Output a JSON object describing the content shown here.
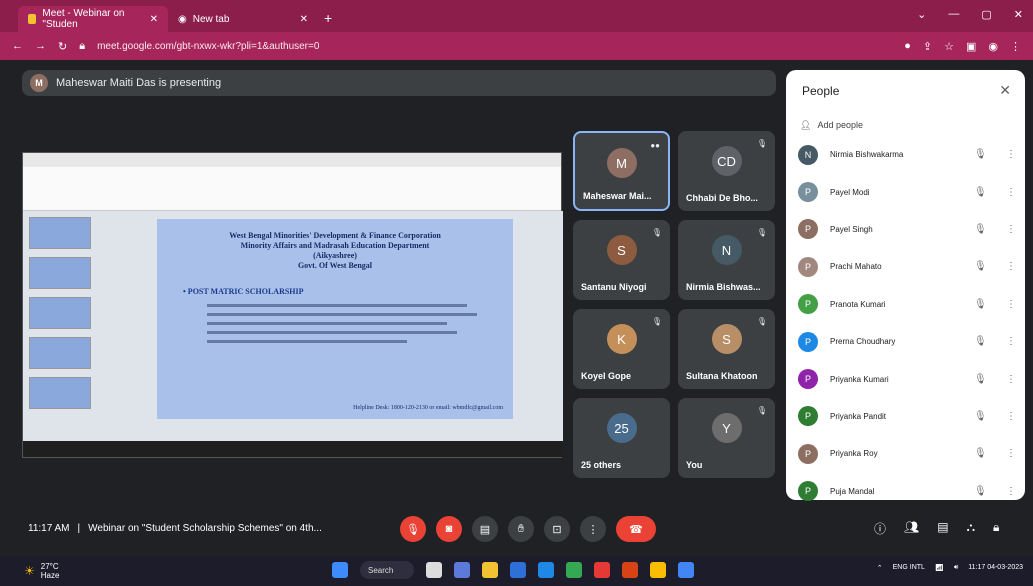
{
  "browser": {
    "tabs": [
      {
        "label": "Meet - Webinar on \"Studen",
        "active": true
      },
      {
        "label": "New tab",
        "active": false
      }
    ],
    "url": "meet.google.com/gbt-nxwx-wkr?pli=1&authuser=0",
    "accent": "#a6265c"
  },
  "presenting_banner": "Maheswar Maiti Das is presenting",
  "presenter_initial": "M",
  "shared_slide": {
    "title_line1": "West Bengal Minorities' Development & Finance Corporation",
    "title_line2": "Minority Affairs and Madrasah Education Department",
    "title_line3": "(Aikyashree)",
    "title_line4": "Govt. Of West Bengal",
    "heading": "• POST MATRIC SCHOLARSHIP",
    "contact": "Helpline Desk: 1800-120-2130 or email: wbmdfc@gmail.com"
  },
  "tiles": [
    {
      "name": "Maheswar Mai...",
      "initial": "M",
      "color": "#8e6e62",
      "active": true
    },
    {
      "name": "Chhabi De Bho...",
      "initial": "CD",
      "color": "#5f6368",
      "active": false
    },
    {
      "name": "Santanu Niyogi",
      "initial": "S",
      "color": "#8d5b3f",
      "active": false
    },
    {
      "name": "Nirmia Bishwas...",
      "initial": "N",
      "color": "#455a64",
      "active": false
    },
    {
      "name": "Koyel Gope",
      "initial": "K",
      "color": "#c58f5a",
      "active": false
    },
    {
      "name": "Sultana Khatoon",
      "initial": "S",
      "color": "#b88e66",
      "active": false
    },
    {
      "name": "25 others",
      "initial": "25",
      "color": "#4a6c8c",
      "active": false
    },
    {
      "name": "You",
      "initial": "Y",
      "color": "#6d6d6d",
      "active": false
    }
  ],
  "people_panel": {
    "title": "People",
    "add_people": "Add people",
    "people": [
      {
        "name": "Nirmia Bishwakarma",
        "initial": "N",
        "color": "#455a64"
      },
      {
        "name": "Payel Modi",
        "initial": "P",
        "color": "#78909c"
      },
      {
        "name": "Payel Singh",
        "initial": "P",
        "color": "#8d6e63"
      },
      {
        "name": "Prachi Mahato",
        "initial": "P",
        "color": "#a1887f"
      },
      {
        "name": "Pranota Kumari",
        "initial": "P",
        "color": "#43a047"
      },
      {
        "name": "Prerna Choudhary",
        "initial": "P",
        "color": "#1e88e5"
      },
      {
        "name": "Priyanka Kumari",
        "initial": "P",
        "color": "#8e24aa"
      },
      {
        "name": "Priyanka Pandit",
        "initial": "P",
        "color": "#2e7d32"
      },
      {
        "name": "Priyanka Roy",
        "initial": "P",
        "color": "#8d6e63"
      },
      {
        "name": "Puja Mandal",
        "initial": "P",
        "color": "#2e7d32"
      }
    ]
  },
  "meeting_time": "11:17 AM",
  "meeting_name": "Webinar on \"Student Scholarship Schemes\" on 4th...",
  "taskbar": {
    "weather_temp": "27°C",
    "weather_desc": "Haze",
    "search_label": "Search",
    "lang": "ENG",
    "lang_sub": "INTL",
    "time": "11:17",
    "date": "04-03-2023"
  }
}
